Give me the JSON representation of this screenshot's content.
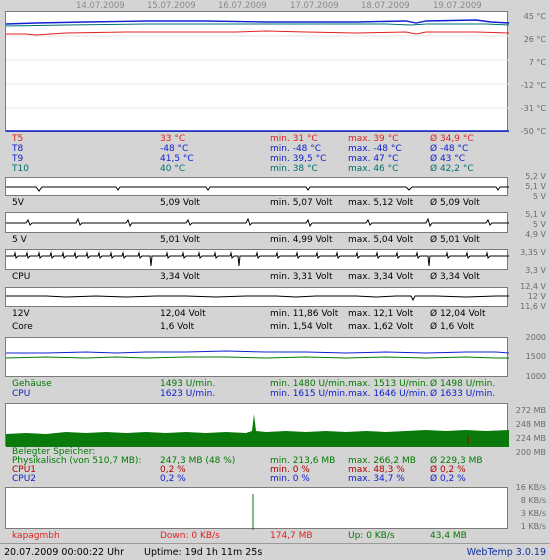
{
  "dates": [
    "14.07.2009",
    "15.07.2009",
    "16.07.2009",
    "17.07.2009",
    "18.07.2009",
    "19.07.2009"
  ],
  "temps": {
    "axis": [
      "45 °C",
      "26 °C",
      "7 °C",
      "-12 °C",
      "-31 °C",
      "-50 °C"
    ],
    "rows": [
      {
        "name": "T5",
        "cur": "33 °C",
        "min": "min. 31 °C",
        "max": "max. 39 °C",
        "avg": "Ø 34,9 °C",
        "color": "#e02020"
      },
      {
        "name": "T8",
        "cur": "-48 °C",
        "min": "min. -48 °C",
        "max": "max. -48 °C",
        "avg": "Ø -48 °C",
        "color": "#1020d0"
      },
      {
        "name": "T9",
        "cur": "41,5 °C",
        "min": "min. 39,5 °C",
        "max": "max. 47 °C",
        "avg": "Ø 43 °C",
        "color": "#1020d0"
      },
      {
        "name": "T10",
        "cur": "40 °C",
        "min": "min. 38 °C",
        "max": "max. 46 °C",
        "avg": "Ø 42,2 °C",
        "color": "#007070"
      }
    ]
  },
  "volt5v": {
    "axis": [
      "5,2 V",
      "5,1 V",
      "5 V"
    ],
    "name": "5V",
    "cur": "5,09 Volt",
    "min": "min. 5,07 Volt",
    "max": "max. 5,12 Volt",
    "avg": "Ø 5,09 Volt"
  },
  "volt5v2": {
    "axis": [
      "5,1 V",
      "5 V",
      "4,9 V"
    ],
    "name": "5 V",
    "cur": "5,01 Volt",
    "min": "min. 4,99 Volt",
    "max": "max. 5,04 Volt",
    "avg": "Ø 5,01 Volt"
  },
  "voltcpu": {
    "axis": [
      "3,35 V",
      "3,3 V"
    ],
    "name": "CPU",
    "cur": "3,34 Volt",
    "min": "min. 3,31 Volt",
    "max": "max. 3,34 Volt",
    "avg": "Ø 3,34 Volt"
  },
  "volt12": {
    "axis": [
      "12,4 V",
      "12 V",
      "11,6 V"
    ],
    "name": "12V",
    "cur": "12,04 Volt",
    "min": "min. 11,86 Volt",
    "max": "max. 12,1 Volt",
    "avg": "Ø 12,04 Volt"
  },
  "core": {
    "name": "Core",
    "cur": "1,6 Volt",
    "min": "min. 1,54 Volt",
    "max": "max. 1,62 Volt",
    "avg": "Ø 1,6 Volt"
  },
  "fans": {
    "axis": [
      "2000",
      "1500",
      "1000"
    ],
    "rows": [
      {
        "name": "Gehäuse",
        "cur": "1493 U/min.",
        "min": "min. 1480 U/min.",
        "max": "max. 1513 U/min.",
        "avg": "Ø 1498 U/min.",
        "color": "#007a00"
      },
      {
        "name": "CPU",
        "cur": "1623 U/min.",
        "min": "min. 1615 U/min.",
        "max": "max. 1646 U/min.",
        "avg": "Ø 1633 U/min.",
        "color": "#1020d0"
      }
    ]
  },
  "mem": {
    "axis": [
      "272 MB",
      "248 MB",
      "224 MB",
      "200 MB"
    ],
    "header": "Belegter Speicher:",
    "rows": [
      {
        "name": "Physikalisch (von 510,7 MB):",
        "cur": "247,3 MB (48 %)",
        "min": "min. 213,6 MB",
        "max": "max. 266,2 MB",
        "avg": "Ø 229,3 MB",
        "color": "#007a00"
      },
      {
        "name": "CPU1",
        "cur": "0,2 %",
        "min": "min. 0 %",
        "max": "max. 48,3 %",
        "avg": "Ø 0,2 %",
        "color": "#b00000"
      },
      {
        "name": "CPU2",
        "cur": "0,2 %",
        "min": "min. 0 %",
        "max": "max. 34,7 %",
        "avg": "Ø 0,2 %",
        "color": "#1020d0"
      }
    ]
  },
  "net": {
    "axis": [
      "16 KB/s",
      "8 KB/s",
      "3 KB/s",
      "1 KB/s"
    ],
    "host": "kapagmbh",
    "down": "Down: 0 KB/s",
    "down_total": "174,7 MB",
    "up": "Up: 0 KB/s",
    "up_total": "43,4 MB"
  },
  "status": {
    "datetime": "20.07.2009 00:00:22 Uhr",
    "uptime": "Uptime: 19d 1h 11m 25s",
    "app": "WebTemp 3.0.19"
  }
}
